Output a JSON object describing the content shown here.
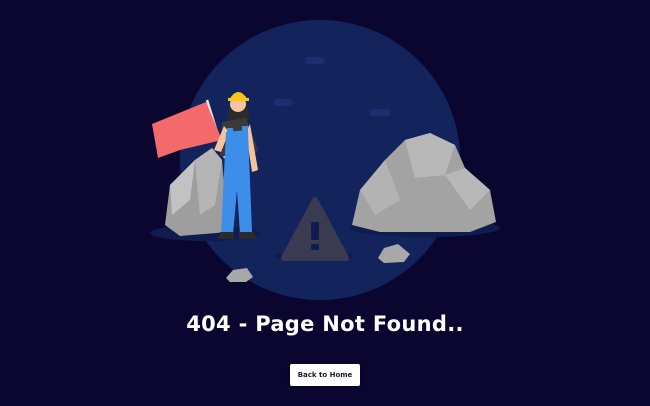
{
  "error": {
    "title": "404 - Page Not Found.."
  },
  "actions": {
    "home_label": "Back to Home"
  },
  "colors": {
    "background": "#0b0630",
    "circle": "#13235c",
    "flag": "#f46a6a",
    "overalls": "#3d8ee8",
    "helmet": "#f5c518",
    "rock": "#a3a3a3",
    "warning_sign": "#3a3a52",
    "button_bg": "#ffffff"
  },
  "icons": {
    "warning": "warning-triangle-icon"
  }
}
